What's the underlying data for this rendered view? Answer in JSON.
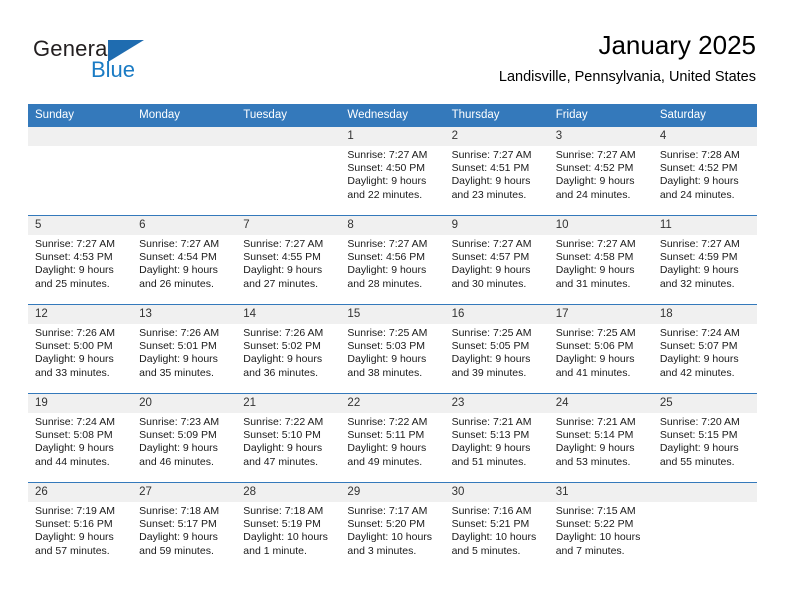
{
  "brand": {
    "name_part1": "General",
    "name_part2": "Blue",
    "accent_color": "#1f6cb0"
  },
  "header": {
    "title": "January 2025",
    "subtitle": "Landisville, Pennsylvania, United States"
  },
  "calendar": {
    "header_bg": "#3479bb",
    "daynum_bg": "#f0f0f0",
    "weekday_headers": [
      "Sunday",
      "Monday",
      "Tuesday",
      "Wednesday",
      "Thursday",
      "Friday",
      "Saturday"
    ],
    "weeks": [
      [
        {
          "day": "",
          "empty": true
        },
        {
          "day": "",
          "empty": true
        },
        {
          "day": "",
          "empty": true
        },
        {
          "day": "1",
          "sunrise": "Sunrise: 7:27 AM",
          "sunset": "Sunset: 4:50 PM",
          "daylight1": "Daylight: 9 hours",
          "daylight2": "and 22 minutes."
        },
        {
          "day": "2",
          "sunrise": "Sunrise: 7:27 AM",
          "sunset": "Sunset: 4:51 PM",
          "daylight1": "Daylight: 9 hours",
          "daylight2": "and 23 minutes."
        },
        {
          "day": "3",
          "sunrise": "Sunrise: 7:27 AM",
          "sunset": "Sunset: 4:52 PM",
          "daylight1": "Daylight: 9 hours",
          "daylight2": "and 24 minutes."
        },
        {
          "day": "4",
          "sunrise": "Sunrise: 7:28 AM",
          "sunset": "Sunset: 4:52 PM",
          "daylight1": "Daylight: 9 hours",
          "daylight2": "and 24 minutes."
        }
      ],
      [
        {
          "day": "5",
          "sunrise": "Sunrise: 7:27 AM",
          "sunset": "Sunset: 4:53 PM",
          "daylight1": "Daylight: 9 hours",
          "daylight2": "and 25 minutes."
        },
        {
          "day": "6",
          "sunrise": "Sunrise: 7:27 AM",
          "sunset": "Sunset: 4:54 PM",
          "daylight1": "Daylight: 9 hours",
          "daylight2": "and 26 minutes."
        },
        {
          "day": "7",
          "sunrise": "Sunrise: 7:27 AM",
          "sunset": "Sunset: 4:55 PM",
          "daylight1": "Daylight: 9 hours",
          "daylight2": "and 27 minutes."
        },
        {
          "day": "8",
          "sunrise": "Sunrise: 7:27 AM",
          "sunset": "Sunset: 4:56 PM",
          "daylight1": "Daylight: 9 hours",
          "daylight2": "and 28 minutes."
        },
        {
          "day": "9",
          "sunrise": "Sunrise: 7:27 AM",
          "sunset": "Sunset: 4:57 PM",
          "daylight1": "Daylight: 9 hours",
          "daylight2": "and 30 minutes."
        },
        {
          "day": "10",
          "sunrise": "Sunrise: 7:27 AM",
          "sunset": "Sunset: 4:58 PM",
          "daylight1": "Daylight: 9 hours",
          "daylight2": "and 31 minutes."
        },
        {
          "day": "11",
          "sunrise": "Sunrise: 7:27 AM",
          "sunset": "Sunset: 4:59 PM",
          "daylight1": "Daylight: 9 hours",
          "daylight2": "and 32 minutes."
        }
      ],
      [
        {
          "day": "12",
          "sunrise": "Sunrise: 7:26 AM",
          "sunset": "Sunset: 5:00 PM",
          "daylight1": "Daylight: 9 hours",
          "daylight2": "and 33 minutes."
        },
        {
          "day": "13",
          "sunrise": "Sunrise: 7:26 AM",
          "sunset": "Sunset: 5:01 PM",
          "daylight1": "Daylight: 9 hours",
          "daylight2": "and 35 minutes."
        },
        {
          "day": "14",
          "sunrise": "Sunrise: 7:26 AM",
          "sunset": "Sunset: 5:02 PM",
          "daylight1": "Daylight: 9 hours",
          "daylight2": "and 36 minutes."
        },
        {
          "day": "15",
          "sunrise": "Sunrise: 7:25 AM",
          "sunset": "Sunset: 5:03 PM",
          "daylight1": "Daylight: 9 hours",
          "daylight2": "and 38 minutes."
        },
        {
          "day": "16",
          "sunrise": "Sunrise: 7:25 AM",
          "sunset": "Sunset: 5:05 PM",
          "daylight1": "Daylight: 9 hours",
          "daylight2": "and 39 minutes."
        },
        {
          "day": "17",
          "sunrise": "Sunrise: 7:25 AM",
          "sunset": "Sunset: 5:06 PM",
          "daylight1": "Daylight: 9 hours",
          "daylight2": "and 41 minutes."
        },
        {
          "day": "18",
          "sunrise": "Sunrise: 7:24 AM",
          "sunset": "Sunset: 5:07 PM",
          "daylight1": "Daylight: 9 hours",
          "daylight2": "and 42 minutes."
        }
      ],
      [
        {
          "day": "19",
          "sunrise": "Sunrise: 7:24 AM",
          "sunset": "Sunset: 5:08 PM",
          "daylight1": "Daylight: 9 hours",
          "daylight2": "and 44 minutes."
        },
        {
          "day": "20",
          "sunrise": "Sunrise: 7:23 AM",
          "sunset": "Sunset: 5:09 PM",
          "daylight1": "Daylight: 9 hours",
          "daylight2": "and 46 minutes."
        },
        {
          "day": "21",
          "sunrise": "Sunrise: 7:22 AM",
          "sunset": "Sunset: 5:10 PM",
          "daylight1": "Daylight: 9 hours",
          "daylight2": "and 47 minutes."
        },
        {
          "day": "22",
          "sunrise": "Sunrise: 7:22 AM",
          "sunset": "Sunset: 5:11 PM",
          "daylight1": "Daylight: 9 hours",
          "daylight2": "and 49 minutes."
        },
        {
          "day": "23",
          "sunrise": "Sunrise: 7:21 AM",
          "sunset": "Sunset: 5:13 PM",
          "daylight1": "Daylight: 9 hours",
          "daylight2": "and 51 minutes."
        },
        {
          "day": "24",
          "sunrise": "Sunrise: 7:21 AM",
          "sunset": "Sunset: 5:14 PM",
          "daylight1": "Daylight: 9 hours",
          "daylight2": "and 53 minutes."
        },
        {
          "day": "25",
          "sunrise": "Sunrise: 7:20 AM",
          "sunset": "Sunset: 5:15 PM",
          "daylight1": "Daylight: 9 hours",
          "daylight2": "and 55 minutes."
        }
      ],
      [
        {
          "day": "26",
          "sunrise": "Sunrise: 7:19 AM",
          "sunset": "Sunset: 5:16 PM",
          "daylight1": "Daylight: 9 hours",
          "daylight2": "and 57 minutes."
        },
        {
          "day": "27",
          "sunrise": "Sunrise: 7:18 AM",
          "sunset": "Sunset: 5:17 PM",
          "daylight1": "Daylight: 9 hours",
          "daylight2": "and 59 minutes."
        },
        {
          "day": "28",
          "sunrise": "Sunrise: 7:18 AM",
          "sunset": "Sunset: 5:19 PM",
          "daylight1": "Daylight: 10 hours",
          "daylight2": "and 1 minute."
        },
        {
          "day": "29",
          "sunrise": "Sunrise: 7:17 AM",
          "sunset": "Sunset: 5:20 PM",
          "daylight1": "Daylight: 10 hours",
          "daylight2": "and 3 minutes."
        },
        {
          "day": "30",
          "sunrise": "Sunrise: 7:16 AM",
          "sunset": "Sunset: 5:21 PM",
          "daylight1": "Daylight: 10 hours",
          "daylight2": "and 5 minutes."
        },
        {
          "day": "31",
          "sunrise": "Sunrise: 7:15 AM",
          "sunset": "Sunset: 5:22 PM",
          "daylight1": "Daylight: 10 hours",
          "daylight2": "and 7 minutes."
        },
        {
          "day": "",
          "empty": true
        }
      ]
    ]
  }
}
